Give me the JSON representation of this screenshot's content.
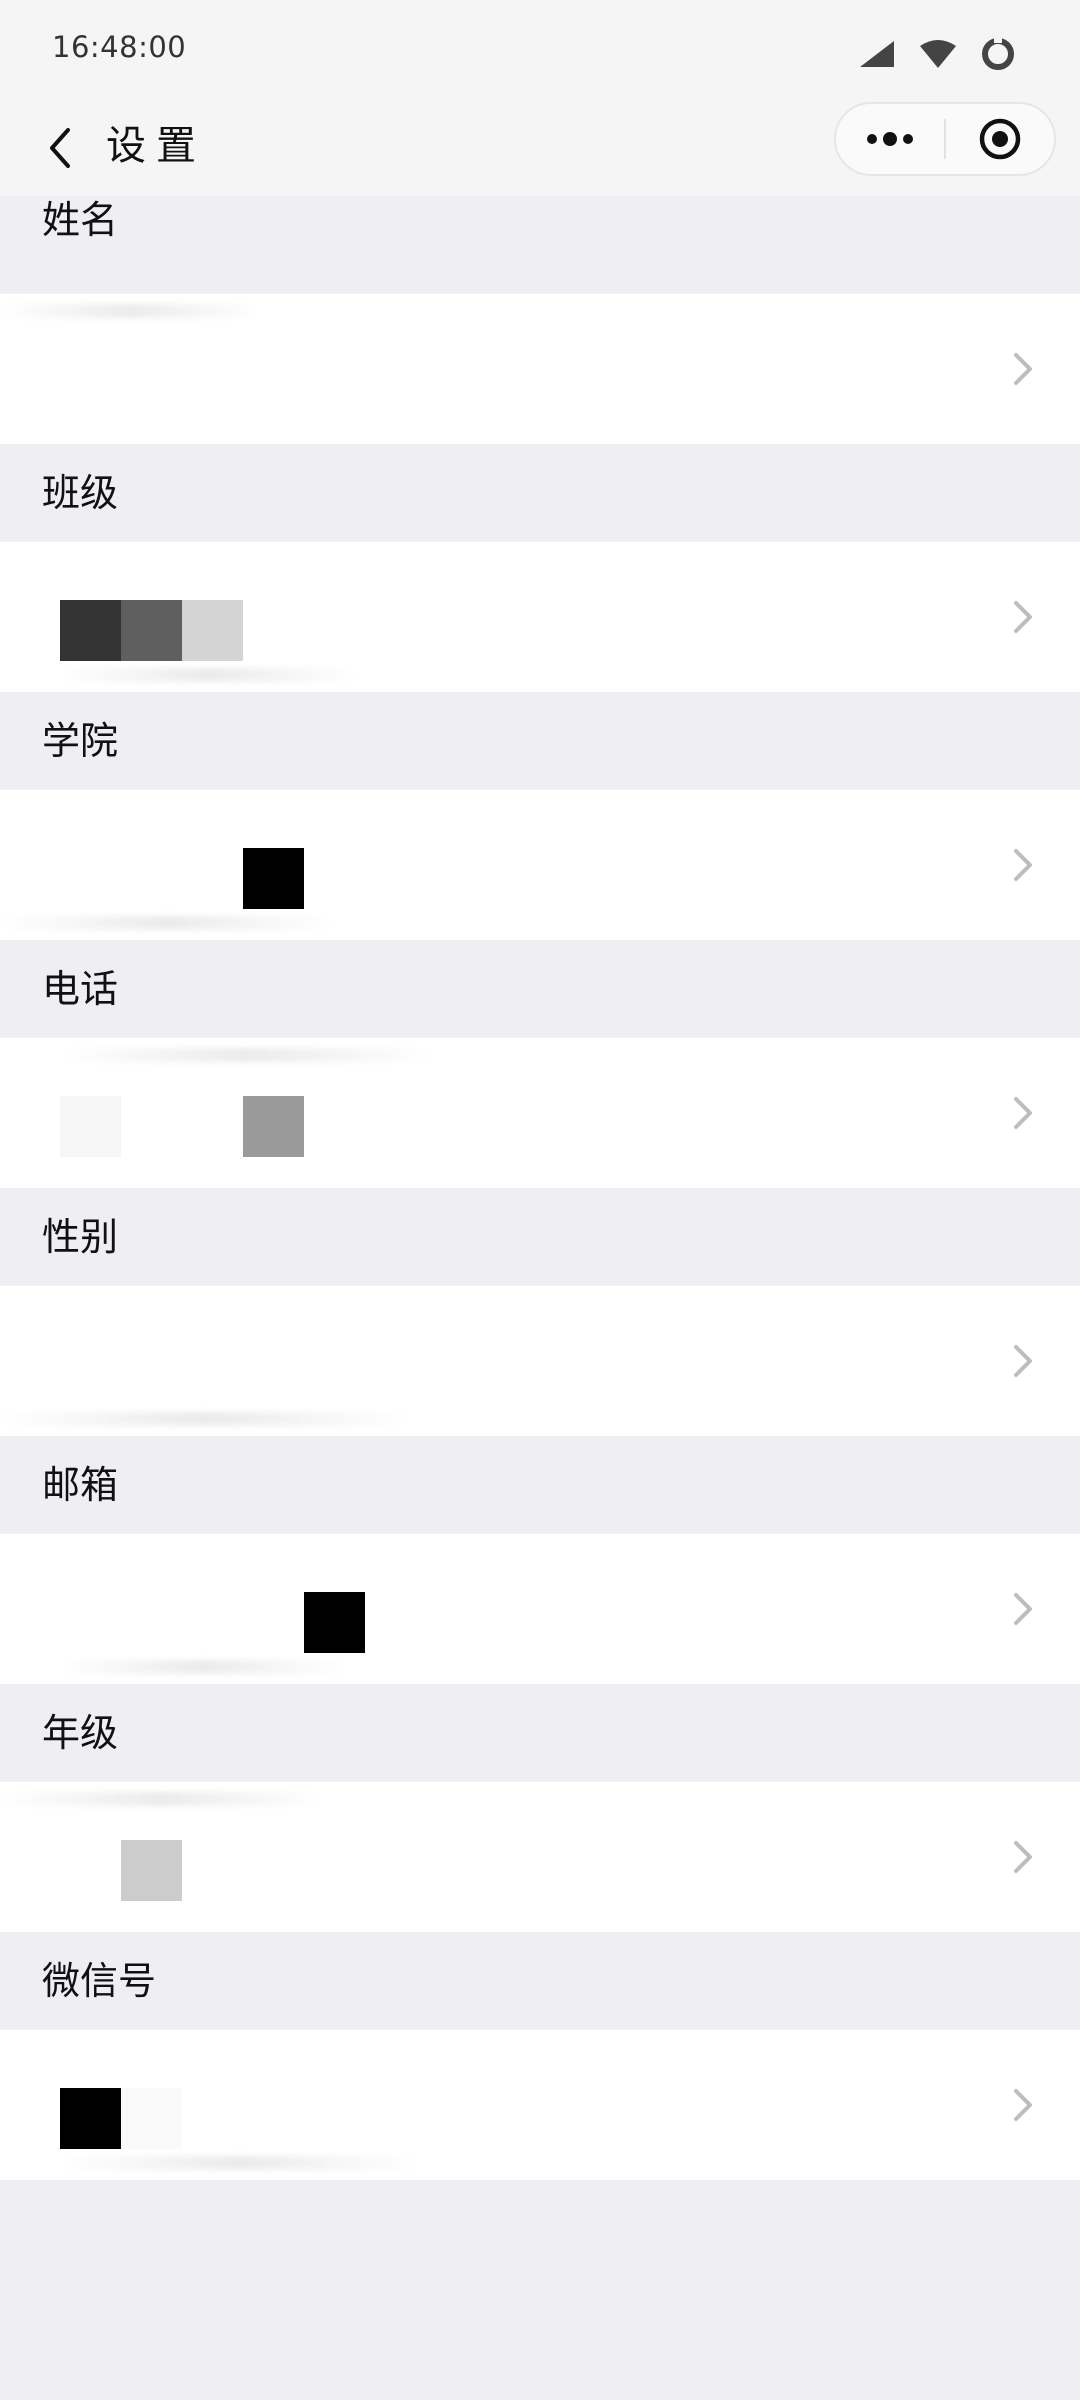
{
  "status_bar": {
    "time": "16:48:00",
    "icons": [
      "signal-icon",
      "wifi-icon",
      "battery-icon"
    ]
  },
  "nav": {
    "title": "设置",
    "back_icon": "chevron-left-icon",
    "capsule": {
      "more_icon": "more-dots-icon",
      "close_icon": "target-circle-icon"
    }
  },
  "fields": [
    {
      "label": "姓名",
      "value_blocks": []
    },
    {
      "label": "班级",
      "value_blocks": [
        "#333333",
        "#5F5F5F",
        "#D4D4D4"
      ]
    },
    {
      "label": "学院",
      "value_blocks": [
        "transparent",
        "transparent",
        "transparent",
        "#000000"
      ]
    },
    {
      "label": "电话",
      "value_blocks": [
        "#F6F6F6",
        "transparent",
        "transparent",
        "#9A9A9A"
      ]
    },
    {
      "label": "性别",
      "value_blocks": []
    },
    {
      "label": "邮箱",
      "value_blocks": [
        "transparent",
        "transparent",
        "transparent",
        "transparent",
        "#000000"
      ]
    },
    {
      "label": "年级",
      "value_blocks": [
        "transparent",
        "#CCCCCC"
      ]
    },
    {
      "label": "微信号",
      "value_blocks": [
        "#000000",
        "#FAFAFA"
      ]
    }
  ],
  "colors": {
    "section_bg": "#EFEEF3",
    "row_bg": "#FFFFFF",
    "chevron": "#BDBDBD"
  }
}
